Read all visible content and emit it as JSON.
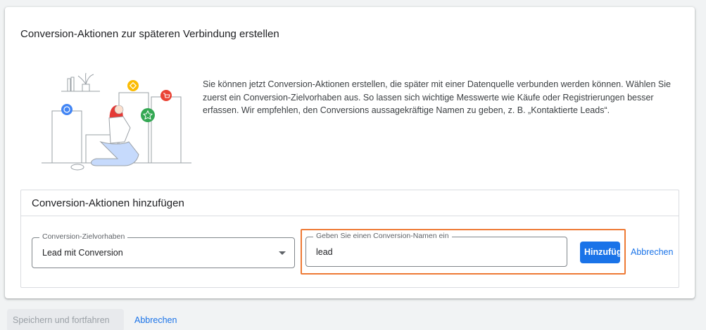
{
  "card": {
    "title": "Conversion-Aktionen zur späteren Verbindung erstellen",
    "description": "Sie können jetzt Conversion-Aktionen erstellen, die später mit einer Datenquelle verbunden werden können. Wählen Sie zuerst ein Conversion-Zielvorhaben aus. So lassen sich wichtige Messwerte wie Käufe oder Registrierungen besser erfassen. Wir empfehlen, den Conversions aussagekräftige Namen zu geben, z. B. „Kontaktierte Leads“."
  },
  "add_section": {
    "title": "Conversion-Aktionen hinzufügen",
    "goal_select": {
      "label": "Conversion-Zielvorhaben",
      "value": "Lead mit Conversion"
    },
    "name_input": {
      "label": "Geben Sie einen Conversion-Namen ein",
      "value": "lead"
    },
    "add_button": "Hinzufügen",
    "cancel_link": "Abbrechen"
  },
  "footer": {
    "save_button": "Speichern und fortfahren",
    "cancel_link": "Abbrechen"
  },
  "colors": {
    "accent": "#1a73e8",
    "highlight": "#ee7a35"
  },
  "icons": [
    "sync-icon",
    "tag-icon",
    "cart-icon",
    "star-icon",
    "dropdown-caret-icon"
  ]
}
